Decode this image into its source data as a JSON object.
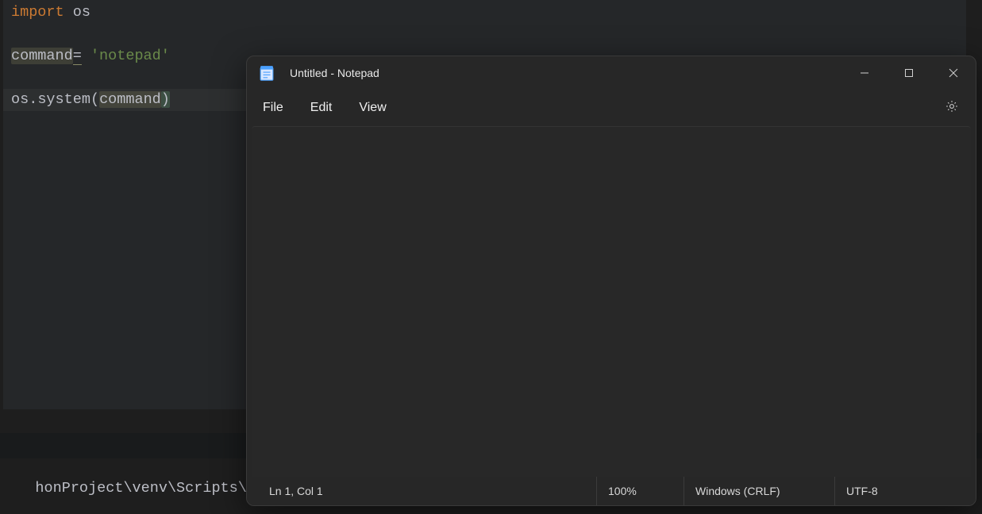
{
  "editor": {
    "line1": {
      "keyword": "import",
      "module": "os"
    },
    "line2": {
      "var": "command",
      "op": "=",
      "string": "'notepad'"
    },
    "line3": {
      "obj": "os",
      "dot": ".",
      "func": "system",
      "lparen": "(",
      "arg": "command",
      "rparen": ")"
    }
  },
  "terminal": {
    "fragment": "honProject\\venv\\Scripts\\python.e"
  },
  "notepad": {
    "title": "Untitled - Notepad",
    "menus": {
      "file": "File",
      "edit": "Edit",
      "view": "View"
    },
    "status": {
      "position": "Ln 1, Col 1",
      "zoom": "100%",
      "line_ending": "Windows (CRLF)",
      "encoding": "UTF-8"
    },
    "content": ""
  }
}
